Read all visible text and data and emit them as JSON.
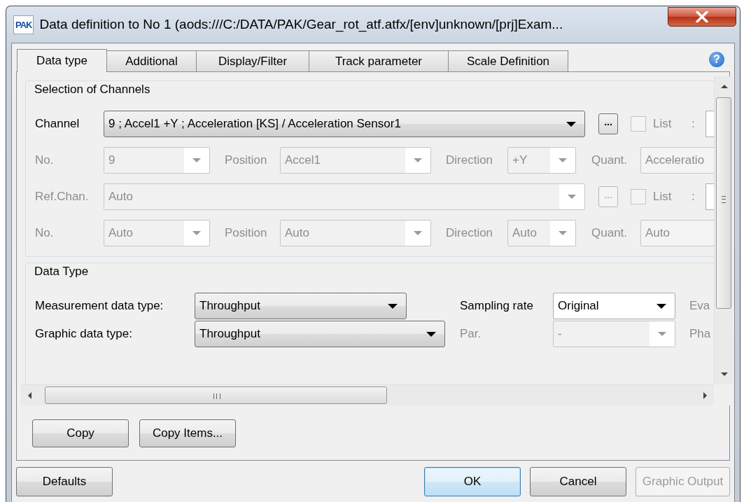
{
  "window": {
    "logo": "PAK",
    "title": "Data definition to No 1 (aods:///C:/DATA/PAK/Gear_rot_atf.atfx/[env]unknown/[prj]Exam..."
  },
  "tabs": [
    {
      "label": "Data type",
      "selected": true
    },
    {
      "label": "Additional",
      "selected": false
    },
    {
      "label": "Display/Filter",
      "selected": false
    },
    {
      "label": "Track parameter",
      "selected": false
    },
    {
      "label": "Scale Definition",
      "selected": false
    }
  ],
  "help": "?",
  "groups": [
    {
      "kind": "channels",
      "title": "Selection of Channels",
      "rows": [
        {
          "kind": "main",
          "items": [
            {
              "kind": "label",
              "text": "Channel",
              "disabled": false
            },
            {
              "kind": "button-combo",
              "value": "9 ; Accel1 +Y ; Acceleration [KS] / Acceleration Sensor1",
              "disabled": false
            },
            {
              "kind": "browse",
              "label": "...",
              "disabled": false
            },
            {
              "kind": "check",
              "checked": false,
              "disabled": true
            },
            {
              "kind": "label",
              "text": "List",
              "disabled": true
            },
            {
              "kind": "label",
              "text": ":",
              "disabled": true
            },
            {
              "kind": "field"
            }
          ]
        },
        {
          "kind": "detail",
          "items": [
            {
              "kind": "label",
              "text": "No.",
              "disabled": true
            },
            {
              "kind": "field-combo",
              "value": "9",
              "disabled": true
            },
            {
              "kind": "label",
              "text": "Position",
              "disabled": true
            },
            {
              "kind": "field-combo",
              "value": "Accel1",
              "disabled": true
            },
            {
              "kind": "label",
              "text": "Direction",
              "disabled": true
            },
            {
              "kind": "field-combo",
              "value": "+Y",
              "disabled": true
            },
            {
              "kind": "label",
              "text": "Quant.",
              "disabled": true
            },
            {
              "kind": "text-field",
              "value": "Acceleratio",
              "disabled": true
            }
          ]
        },
        {
          "kind": "main",
          "items": [
            {
              "kind": "label",
              "text": "Ref.Chan.",
              "disabled": true
            },
            {
              "kind": "field-combo",
              "value": "Auto",
              "disabled": true
            },
            {
              "kind": "browse",
              "label": "...",
              "disabled": true
            },
            {
              "kind": "check",
              "checked": false,
              "disabled": true
            },
            {
              "kind": "label",
              "text": "List",
              "disabled": true
            },
            {
              "kind": "label",
              "text": ":",
              "disabled": true
            },
            {
              "kind": "field"
            }
          ]
        },
        {
          "kind": "detail",
          "items": [
            {
              "kind": "label",
              "text": "No.",
              "disabled": true
            },
            {
              "kind": "field-combo",
              "value": "Auto",
              "disabled": true
            },
            {
              "kind": "label",
              "text": "Position",
              "disabled": true
            },
            {
              "kind": "field-combo",
              "value": "Auto",
              "disabled": true
            },
            {
              "kind": "label",
              "text": "Direction",
              "disabled": true
            },
            {
              "kind": "field-combo",
              "value": "Auto",
              "disabled": true
            },
            {
              "kind": "label",
              "text": "Quant.",
              "disabled": true
            },
            {
              "kind": "text-field",
              "value": "Auto",
              "disabled": true
            }
          ]
        }
      ]
    },
    {
      "kind": "data-type",
      "title": "Data Type",
      "rows": [
        {
          "kind": "first",
          "items": [
            {
              "kind": "label",
              "text": "Measurement data type:",
              "disabled": false
            },
            {
              "kind": "button-combo",
              "value": "Throughput",
              "disabled": false
            },
            {
              "kind": "label",
              "text": "Sampling rate",
              "disabled": false
            },
            {
              "kind": "field-combo",
              "value": "Original",
              "disabled": false
            },
            {
              "kind": "label",
              "text": "Eva",
              "disabled": true
            }
          ]
        },
        {
          "kind": "second",
          "items": [
            {
              "kind": "label",
              "text": "Graphic data type:",
              "disabled": false
            },
            {
              "kind": "button-combo",
              "value": "Throughput",
              "disabled": false
            },
            {
              "kind": "label",
              "text": "Par.",
              "disabled": true
            },
            {
              "kind": "field-combo",
              "value": "-",
              "disabled": true
            },
            {
              "kind": "label",
              "text": "Pha",
              "disabled": true
            }
          ]
        }
      ]
    }
  ],
  "buttons": [
    {
      "label": "Copy",
      "disabled": false
    },
    {
      "label": "Copy Items...",
      "disabled": false
    }
  ],
  "footer_buttons": [
    {
      "label": "Defaults",
      "default": false,
      "disabled": false
    },
    {
      "label": "OK",
      "default": true,
      "disabled": false
    },
    {
      "label": "Cancel",
      "default": false,
      "disabled": false
    },
    {
      "label": "Graphic Output",
      "default": false,
      "disabled": true
    }
  ]
}
